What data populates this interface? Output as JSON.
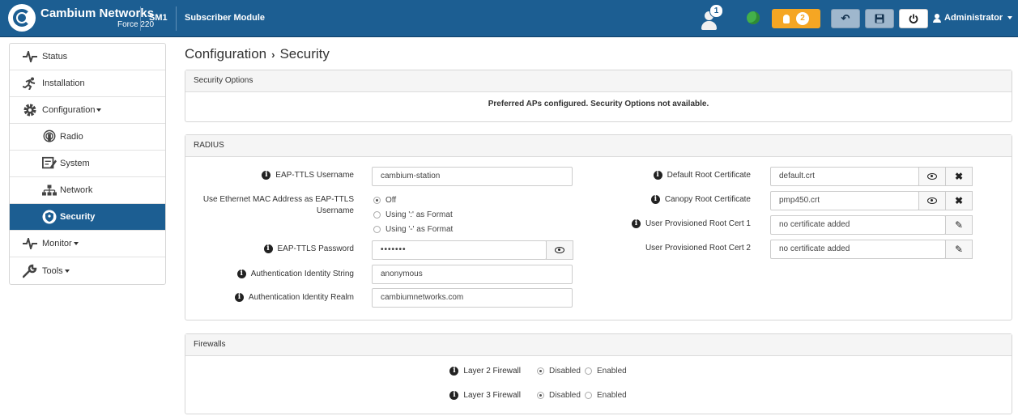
{
  "header": {
    "brand_name": "Cambium Networks",
    "brand_model": "Force 220",
    "device_name": "SM1",
    "device_type": "Subscriber Module",
    "notification_count": "1",
    "alert_count": "2",
    "user": "Administrator",
    "accent_color": "#1c5e92",
    "alert_color": "#f5a623"
  },
  "sidebar": {
    "items": [
      {
        "label": "Status",
        "icon": "pulse-icon"
      },
      {
        "label": "Installation",
        "icon": "runner-icon"
      },
      {
        "label": "Configuration",
        "icon": "gear-icon"
      },
      {
        "label": "Radio",
        "icon": "radio-icon"
      },
      {
        "label": "System",
        "icon": "system-icon"
      },
      {
        "label": "Network",
        "icon": "network-icon"
      },
      {
        "label": "Security",
        "icon": "shield-icon"
      },
      {
        "label": "Monitor",
        "icon": "pulse-icon"
      },
      {
        "label": "Tools",
        "icon": "wrench-icon"
      }
    ]
  },
  "page": {
    "breadcrumb_parent": "Configuration",
    "breadcrumb_current": "Security"
  },
  "security_options": {
    "title": "Security Options",
    "message": "Preferred APs configured. Security Options not available."
  },
  "radius": {
    "title": "RADIUS",
    "eap_username_label": "EAP-TTLS Username",
    "eap_username_value": "cambium-station",
    "mac_label_line1": "Use Ethernet MAC Address as EAP-TTLS",
    "mac_label_line2": "Username",
    "mac_options": [
      "Off",
      "Using ':' as Format",
      "Using '-' as Format"
    ],
    "eap_password_label": "EAP-TTLS Password",
    "eap_password_value": "•••••••",
    "auth_identity_label": "Authentication Identity String",
    "auth_identity_value": "anonymous",
    "auth_realm_label": "Authentication Identity Realm",
    "auth_realm_value": "cambiumnetworks.com",
    "default_root_label": "Default Root Certificate",
    "default_root_value": "default.crt",
    "canopy_root_label": "Canopy Root Certificate",
    "canopy_root_value": "pmp450.crt",
    "user_cert1_label": "User Provisioned Root Cert 1",
    "user_cert1_value": "no certificate added",
    "user_cert2_label": "User Provisioned Root Cert 2",
    "user_cert2_value": "no certificate added"
  },
  "firewalls": {
    "title": "Firewalls",
    "layer2_label": "Layer 2 Firewall",
    "layer3_label": "Layer 3 Firewall",
    "disabled_label": "Disabled",
    "enabled_label": "Enabled"
  }
}
